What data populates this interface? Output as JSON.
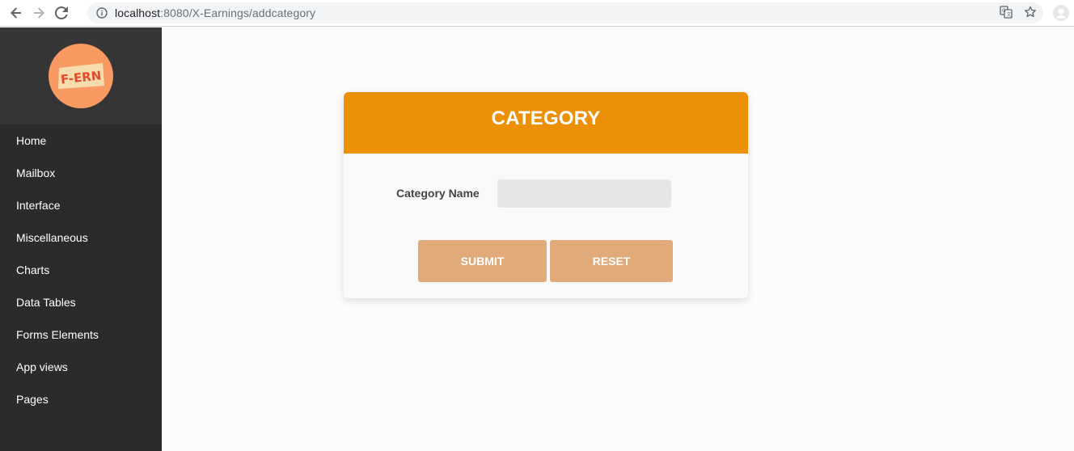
{
  "browser": {
    "url_host": "localhost",
    "url_rest": ":8080/X-Earnings/addcategory"
  },
  "sidebar": {
    "logo_text": "F-ERN",
    "items": [
      {
        "label": "Home"
      },
      {
        "label": "Mailbox"
      },
      {
        "label": "Interface"
      },
      {
        "label": "Miscellaneous"
      },
      {
        "label": "Charts"
      },
      {
        "label": "Data Tables"
      },
      {
        "label": "Forms Elements"
      },
      {
        "label": "App views"
      },
      {
        "label": "Pages"
      }
    ]
  },
  "card": {
    "title": "CATEGORY",
    "category_label": "Category Name",
    "category_value": "",
    "submit_label": "SUBMIT",
    "reset_label": "RESET"
  },
  "colors": {
    "header": "#ec9006",
    "button": "#e0aa7b",
    "sidebar": "#2b2b2b",
    "logo": "#f99a63"
  }
}
